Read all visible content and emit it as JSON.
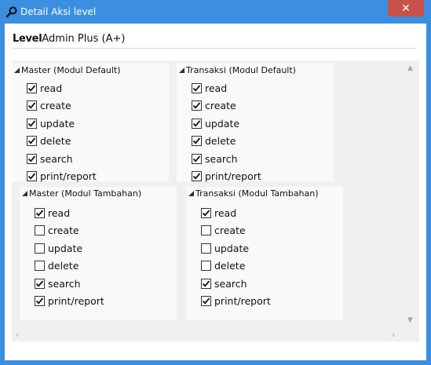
{
  "window": {
    "title": "Detail Aksi level",
    "close_glyph": "✕",
    "colors": {
      "titlebar": "#3c8fe0",
      "close": "#c7514b"
    }
  },
  "level": {
    "label": "Level",
    "value": "Admin Plus (A+)"
  },
  "icons": {
    "title": "search-icon",
    "expander": "expanded-triangle-icon",
    "scroll": [
      "scroll-up-icon",
      "scroll-down-icon",
      "scroll-left-icon",
      "scroll-right-icon"
    ]
  },
  "groups": [
    {
      "title": "Master (Modul Default)",
      "items": [
        {
          "label": "read",
          "checked": true
        },
        {
          "label": "create",
          "checked": true
        },
        {
          "label": "update",
          "checked": true
        },
        {
          "label": "delete",
          "checked": true
        },
        {
          "label": "search",
          "checked": true
        },
        {
          "label": "print/report",
          "checked": true
        }
      ]
    },
    {
      "title": "Transaksi (Modul Default)",
      "items": [
        {
          "label": "read",
          "checked": true
        },
        {
          "label": "create",
          "checked": true
        },
        {
          "label": "update",
          "checked": true
        },
        {
          "label": "delete",
          "checked": true
        },
        {
          "label": "search",
          "checked": true
        },
        {
          "label": "print/report",
          "checked": true
        }
      ]
    },
    {
      "title": "Master (Modul Tambahan)",
      "items": [
        {
          "label": "read",
          "checked": true
        },
        {
          "label": "create",
          "checked": false
        },
        {
          "label": "update",
          "checked": false
        },
        {
          "label": "delete",
          "checked": false
        },
        {
          "label": "search",
          "checked": true
        },
        {
          "label": "print/report",
          "checked": true
        }
      ]
    },
    {
      "title": "Transaksi (Modul Tambahan)",
      "items": [
        {
          "label": "read",
          "checked": true
        },
        {
          "label": "create",
          "checked": false
        },
        {
          "label": "update",
          "checked": false
        },
        {
          "label": "delete",
          "checked": false
        },
        {
          "label": "search",
          "checked": true
        },
        {
          "label": "print/report",
          "checked": true
        }
      ]
    }
  ]
}
